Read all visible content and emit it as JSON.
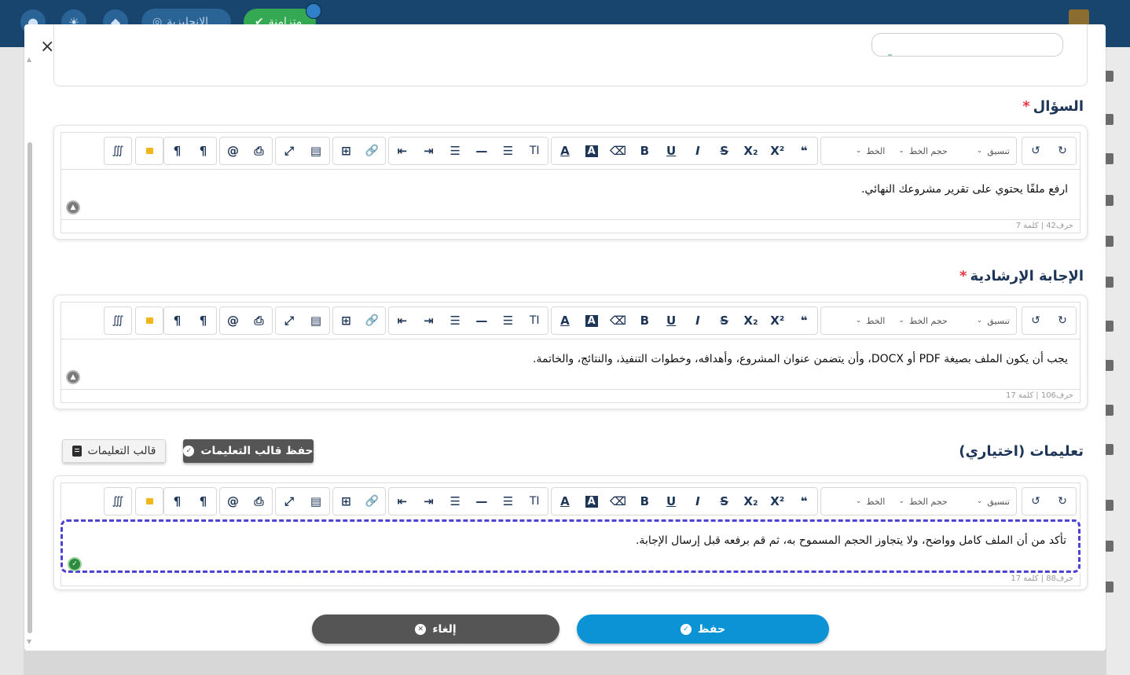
{
  "background": {
    "nav_pills": [
      {
        "label": "الإنجليزية",
        "icon": "globe-icon"
      },
      {
        "label": "متزامنة",
        "icon": "check-circle-icon"
      }
    ]
  },
  "modal": {
    "close_label": "×",
    "question": {
      "label": "السؤال",
      "required_mark": "*",
      "content": "ارفع ملفًا يحتوي على تقرير مشروعك النهائي.",
      "status": "حرف42 | كلمة 7"
    },
    "guide_answer": {
      "label": "الإجابة الإرشادية",
      "required_mark": "*",
      "content": "يجب أن يكون الملف بصيغة PDF أو DOCX، وأن يتضمن عنوان المشروع، وأهدافه، وخطوات التنفيذ، والنتائج، والخاتمة.",
      "status": "حرف106 | كلمة 17"
    },
    "instructions": {
      "label": "تعليمات (اختياري)",
      "content": "تأكد من أن الملف كامل وواضح، ولا يتجاوز الحجم المسموح به، ثم قم برفعه قبل إرسال الإجابة.",
      "status": "حرف88 | كلمة 17",
      "save_template_label": "حفظ قالب التعليمات",
      "template_label": "قالب التعليمات"
    },
    "toolbar": {
      "format_label": "تنسيق",
      "font_size_label": "حجم الخط",
      "font_label": "الخط",
      "chevron": "⌄",
      "glyphs": {
        "redo": "↻",
        "undo": "↺",
        "quote": "❝",
        "superscript": "X²",
        "subscript": "X₂",
        "strike": "S",
        "italic": "I",
        "underline": "U",
        "bold": "B",
        "eraser": "⌫",
        "bg_color": "A",
        "text_color": "A",
        "text_size": "TI",
        "list_ordered": "☰",
        "hr": "—",
        "align": "☰",
        "indent": "⇥",
        "outdent": "⇤",
        "link": "🔗",
        "table": "⊞",
        "template": "▤",
        "fullscreen": "⤢",
        "print": "⎙",
        "mention": "@",
        "ltr": "¶",
        "rtl": "¶",
        "special_chars": "∭"
      }
    },
    "buttons": {
      "save_label": "حفظ",
      "cancel_label": "إلغاء"
    }
  }
}
